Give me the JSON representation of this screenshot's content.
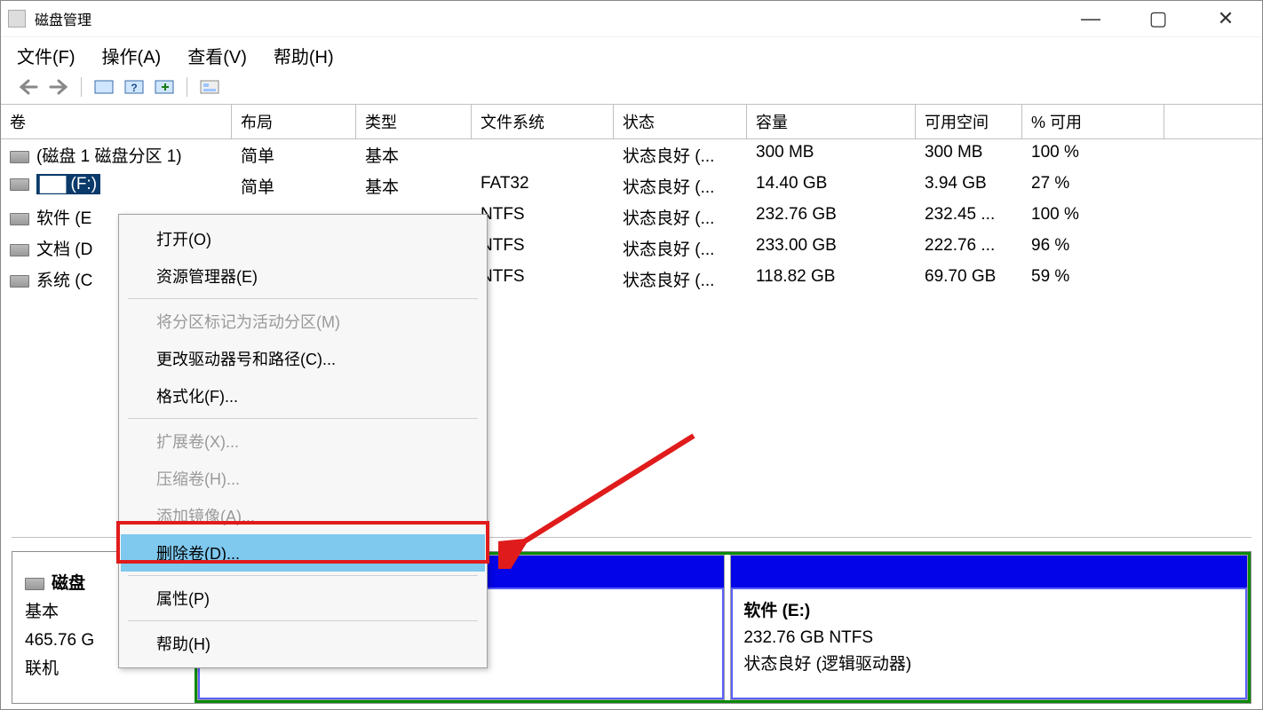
{
  "window": {
    "title": "磁盘管理"
  },
  "winbtns": {
    "min": "—",
    "max": "▢",
    "close": "✕"
  },
  "menu": {
    "file": "文件(F)",
    "action": "操作(A)",
    "view": "查看(V)",
    "help": "帮助(H)"
  },
  "columns": {
    "c0": "卷",
    "c1": "布局",
    "c2": "类型",
    "c3": "文件系统",
    "c4": "状态",
    "c5": "容量",
    "c6": "可用空间",
    "c7": "% 可用"
  },
  "rows": [
    {
      "name": "(磁盘 1 磁盘分区 1)",
      "layout": "简单",
      "type": "基本",
      "fs": "",
      "status": "状态良好 (...",
      "cap": "300 MB",
      "free": "300 MB",
      "pct": "100 %"
    },
    {
      "name_hl": "▇▇ (F:)",
      "layout": "简单",
      "type": "基本",
      "fs": "FAT32",
      "status": "状态良好 (...",
      "cap": "14.40 GB",
      "free": "3.94 GB",
      "pct": "27 %",
      "selected": true
    },
    {
      "name": "软件 (E",
      "layout": "",
      "type": "",
      "fs": "NTFS",
      "status": "状态良好 (...",
      "cap": "232.76 GB",
      "free": "232.45 ...",
      "pct": "100 %"
    },
    {
      "name": "文档 (D",
      "layout": "",
      "type": "",
      "fs": "NTFS",
      "status": "状态良好 (...",
      "cap": "233.00 GB",
      "free": "222.76 ...",
      "pct": "96 %"
    },
    {
      "name": "系统 (C",
      "layout": "",
      "type": "",
      "fs": "NTFS",
      "status": "状态良好 (...",
      "cap": "118.82 GB",
      "free": "69.70 GB",
      "pct": "59 %"
    }
  ],
  "ctx": {
    "open": "打开(O)",
    "explorer": "资源管理器(E)",
    "mark_active": "将分区标记为活动分区(M)",
    "change_letter": "更改驱动器号和路径(C)...",
    "format": "格式化(F)...",
    "extend": "扩展卷(X)...",
    "shrink": "压缩卷(H)...",
    "mirror": "添加镜像(A)...",
    "delete": "删除卷(D)...",
    "props": "属性(P)",
    "help": "帮助(H)"
  },
  "disk": {
    "title": "磁盘",
    "type": "基本",
    "size": "465.76 G",
    "status": "联机",
    "part_hidden_status": "状态良好 (逻辑驱动器)",
    "part_right_name": "软件   (E:)",
    "part_right_size": "232.76 GB NTFS",
    "part_right_status": "状态良好 (逻辑驱动器)"
  }
}
